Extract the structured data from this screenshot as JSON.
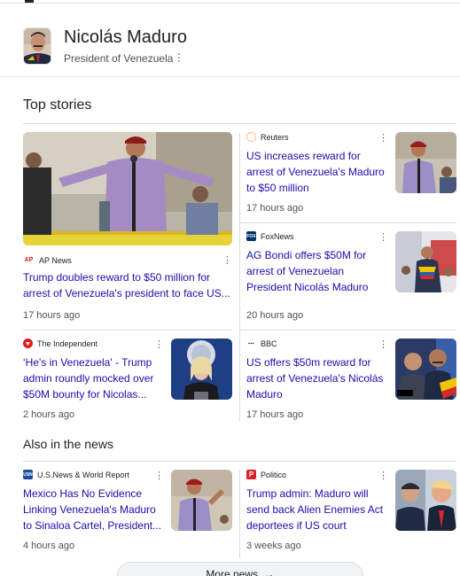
{
  "entity": {
    "name": "Nicolás Maduro",
    "subtitle": "President of Venezuela",
    "menu_icon": "more-vert-icon"
  },
  "top_stories": {
    "title": "Top stories",
    "items": [
      {
        "source": "AP News",
        "logo_text": "AP",
        "logo_color": "#ffffff",
        "logo_fg": "#e01e1e",
        "headline": "Trump doubles reward to $50 million for arrest of Venezuela's president to face US...",
        "time": "17 hours ago"
      },
      {
        "source": "Reuters",
        "logo_text": "",
        "logo_color": "#ff8000",
        "logo_fg": "#ffffff",
        "headline": "US increases reward for arrest of Venezuela's Maduro to $50 million",
        "time": "17 hours ago"
      },
      {
        "source": "FoxNews",
        "logo_text": "FOX",
        "logo_color": "#003366",
        "logo_fg": "#ffffff",
        "headline": "AG Bondi offers $50M for arrest of Venezuelan President Nicolás Maduro",
        "time": "20 hours ago"
      },
      {
        "source": "The Independent",
        "logo_text": "",
        "logo_color": "#e21b1b",
        "logo_fg": "#ffffff",
        "headline": "‘He's in Venezuela' - Trump admin roundly mocked over $50M bounty for Nicolas...",
        "time": "2 hours ago"
      },
      {
        "source": "BBC",
        "logo_text": "BBC",
        "logo_color": "#000000",
        "logo_fg": "#ffffff",
        "headline": "US offers $50m reward for arrest of Venezuela's Nicolás Maduro",
        "time": "17 hours ago"
      }
    ]
  },
  "also_in_news": {
    "title": "Also in the news",
    "items": [
      {
        "source": "U.S.News & World Report",
        "logo_text": "USN",
        "logo_color": "#1b4f9c",
        "logo_fg": "#ffffff",
        "headline": "Mexico Has No Evidence Linking Venezuela's Maduro to Sinaloa Cartel, President...",
        "time": "4 hours ago"
      },
      {
        "source": "Politico",
        "logo_text": "P",
        "logo_color": "#dc1f26",
        "logo_fg": "#ffffff",
        "headline": "Trump admin: Maduro will send back Alien Enemies Act deportees if US court orders...",
        "time": "3 weeks ago"
      }
    ]
  },
  "more_news": {
    "label": "More news",
    "icon": "arrow-right-icon"
  },
  "colors": {
    "link": "#1a0dab",
    "meta": "#4d5156",
    "divider": "#dadce0"
  }
}
